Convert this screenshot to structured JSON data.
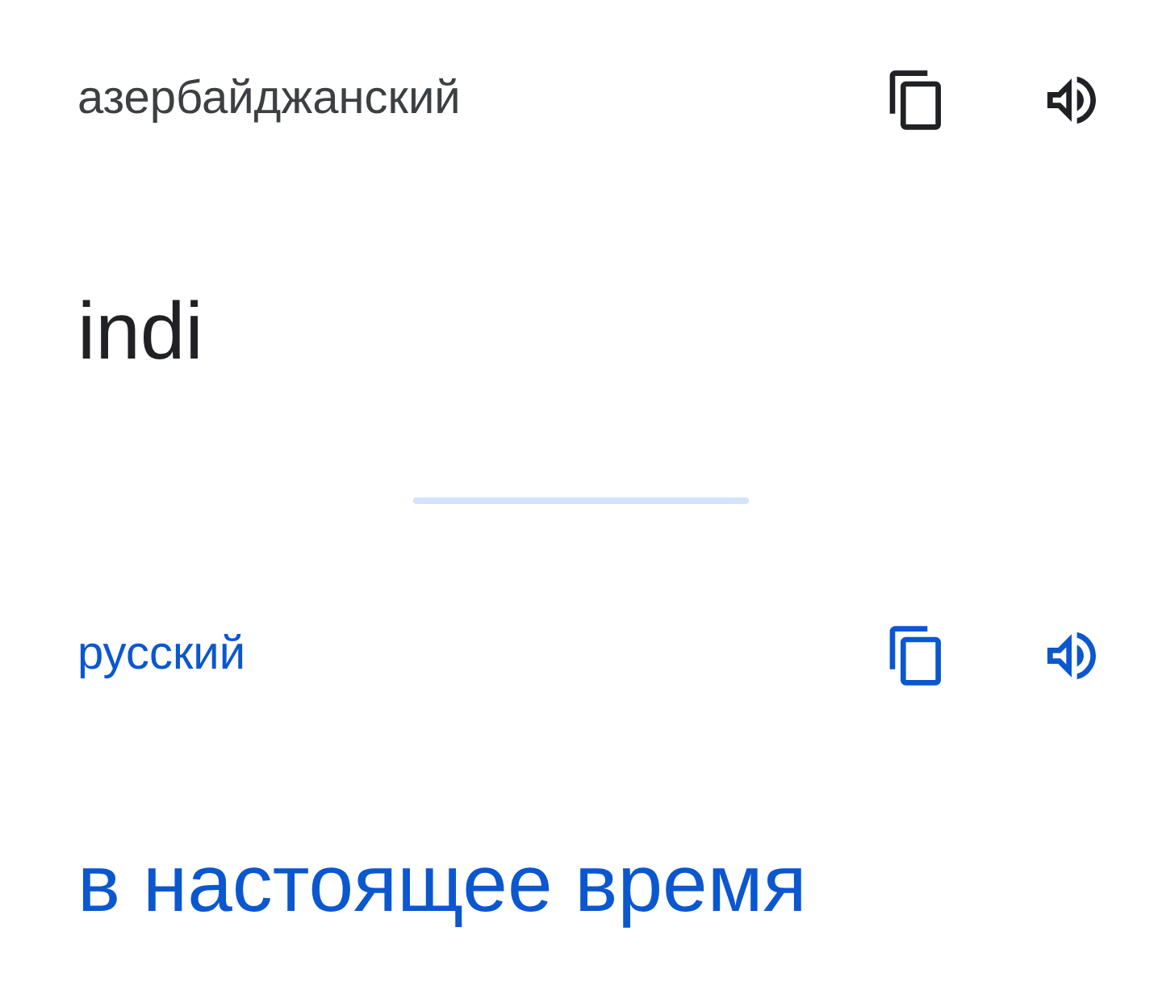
{
  "source": {
    "language": "азербайджанский",
    "text": "indi"
  },
  "target": {
    "language": "русский",
    "text": "в настоящее время"
  }
}
